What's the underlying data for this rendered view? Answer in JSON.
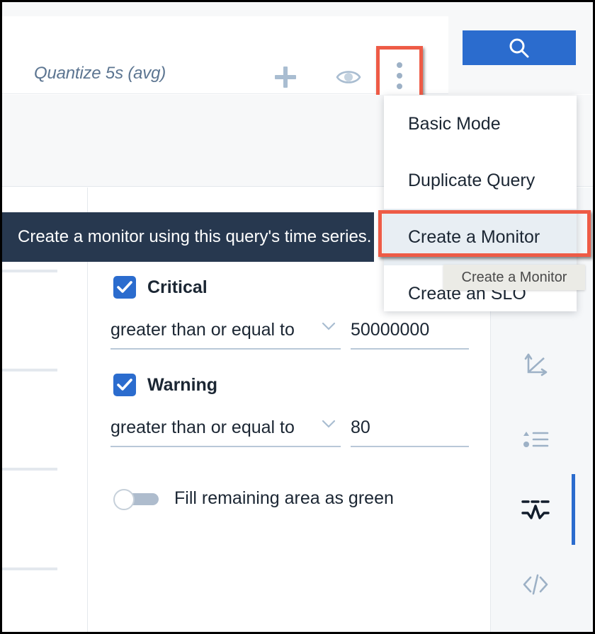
{
  "query_bar": {
    "title": "Quantize 5s (avg)",
    "add_icon": "plus-icon",
    "visibility_icon": "eye-icon",
    "more_icon": "kebab-menu-icon"
  },
  "search": {
    "icon": "search-icon",
    "accent_color": "#2b6cce"
  },
  "menu": {
    "items": [
      {
        "label": "Basic Mode",
        "highlighted": false
      },
      {
        "label": "Duplicate Query",
        "highlighted": false
      },
      {
        "label": "Create a Monitor",
        "highlighted": true
      },
      {
        "label": "Create an SLO",
        "highlighted": false
      }
    ]
  },
  "tooltips": {
    "description": "Create a monitor using this query's time series.",
    "hover_label": "Create a Monitor"
  },
  "thresholds": [
    {
      "name": "Critical",
      "checked": true,
      "comparator": "greater than or equal to",
      "value": "50000000"
    },
    {
      "name": "Warning",
      "checked": true,
      "comparator": "greater than or equal to",
      "value": "80"
    }
  ],
  "fill_toggle": {
    "label": "Fill remaining area as green",
    "enabled": false
  },
  "rail": {
    "items": [
      {
        "icon": "axes-icon",
        "active": false
      },
      {
        "icon": "list-icon",
        "active": false
      },
      {
        "icon": "thresholds-icon",
        "active": true
      },
      {
        "icon": "code-icon",
        "active": false
      }
    ]
  },
  "highlight_color": "#ee5b46"
}
